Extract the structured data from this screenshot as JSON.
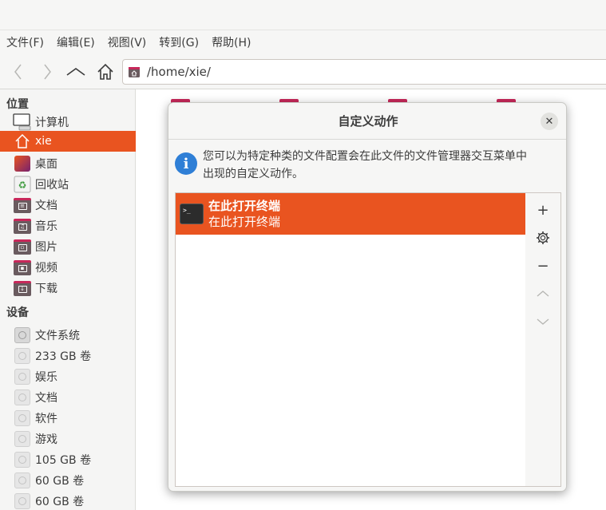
{
  "menubar": {
    "items": [
      "文件(F)",
      "编辑(E)",
      "视图(V)",
      "转到(G)",
      "帮助(H)"
    ]
  },
  "toolbar": {
    "back_icon": "back-icon",
    "forward_icon": "forward-icon",
    "up_icon": "up-icon",
    "home_icon": "home-icon",
    "path": "/home/xie/"
  },
  "sidebar": {
    "places_title": "位置",
    "places": [
      {
        "label": "计算机",
        "icon": "computer-icon"
      },
      {
        "label": "xie",
        "icon": "home-folder-icon",
        "active": true
      },
      {
        "label": "桌面",
        "icon": "desktop-icon"
      },
      {
        "label": "回收站",
        "icon": "trash-icon"
      },
      {
        "label": "文档",
        "icon": "documents-folder-icon"
      },
      {
        "label": "音乐",
        "icon": "music-folder-icon"
      },
      {
        "label": "图片",
        "icon": "pictures-folder-icon"
      },
      {
        "label": "视频",
        "icon": "videos-folder-icon"
      },
      {
        "label": "下载",
        "icon": "downloads-folder-icon"
      }
    ],
    "devices_title": "设备",
    "devices": [
      {
        "label": "文件系统"
      },
      {
        "label": "233 GB 卷"
      },
      {
        "label": "娱乐"
      },
      {
        "label": "文档"
      },
      {
        "label": "软件"
      },
      {
        "label": "游戏"
      },
      {
        "label": "105 GB 卷"
      },
      {
        "label": "60 GB 卷"
      },
      {
        "label": "60 GB 卷"
      }
    ]
  },
  "dialog": {
    "title": "自定义动作",
    "close_symbol": "✕",
    "info_line1": "您可以为特定种类的文件配置会在此文件的文件管理器交互菜单中",
    "info_line2": "出现的自定义动作。",
    "actions": [
      {
        "name": "在此打开终端",
        "description": "在此打开终端",
        "selected": true
      }
    ],
    "buttons": {
      "add": "+",
      "edit": "⚙",
      "remove": "−",
      "up": "︿",
      "down": "﹀"
    }
  },
  "colors": {
    "accent": "#e95420",
    "folder_tab": "#c7285a",
    "info_blue": "#2f7fd6"
  }
}
